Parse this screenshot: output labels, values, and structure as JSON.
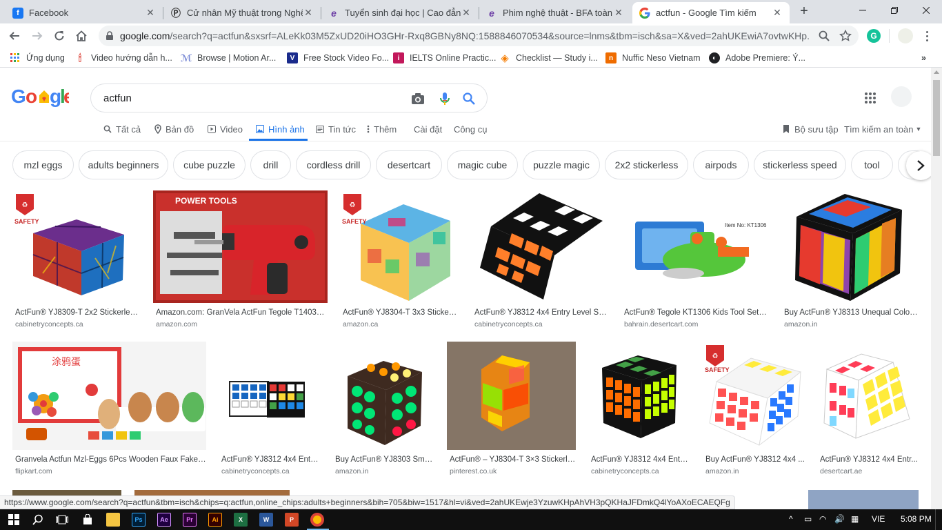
{
  "tabs": [
    {
      "title": "Facebook",
      "icon": "facebook-icon"
    },
    {
      "title": "Cử nhân Mỹ thuật trong Nghệ",
      "icon": "p-icon"
    },
    {
      "title": "Tuyển sinh đại học | Cao đẳng",
      "icon": "e-icon"
    },
    {
      "title": "Phim nghệ thuật - BFA toàn cầ",
      "icon": "e-icon"
    },
    {
      "title": "actfun - Google Tìm kiếm",
      "icon": "google-icon",
      "active": true
    }
  ],
  "omnibox": {
    "host": "google.com",
    "path": "/search?q=actfun&sxsrf=ALeKk03M5ZxUD20iHO3GHr-Rxq8GBNy8NQ:1588846070534&source=lnms&tbm=isch&sa=X&ved=2ahUKEwiA7ovtwKHp..."
  },
  "bookmarks": [
    {
      "label": "Ứng dụng",
      "icon": "apps-grid-icon"
    },
    {
      "label": "Video hướng dẫn h...",
      "icon": "video-icon"
    },
    {
      "label": "Browse | Motion Ar...",
      "icon": "motion-array-icon"
    },
    {
      "label": "Free Stock Video Fo...",
      "icon": "v-icon"
    },
    {
      "label": "IELTS Online Practic...",
      "icon": "ielts-icon"
    },
    {
      "label": "Checklist — Study i...",
      "icon": "checklist-icon"
    },
    {
      "label": "Nuffic Neso Vietnam",
      "icon": "nuffic-icon"
    },
    {
      "label": "Adobe Premiere: Ý...",
      "icon": "premiere-icon"
    }
  ],
  "search": {
    "query": "actfun"
  },
  "nav": {
    "all": "Tất cả",
    "maps": "Bản đồ",
    "video": "Video",
    "images": "Hình ảnh",
    "news": "Tin tức",
    "more": "Thêm",
    "settings": "Cài đặt",
    "tools": "Công cụ",
    "collections": "Bộ sưu tập",
    "safesearch": "Tìm kiếm an toàn"
  },
  "chips": [
    "mzl eggs",
    "adults beginners",
    "cube puzzle",
    "drill",
    "cordless drill",
    "desertcart",
    "magic cube",
    "puzzle magic",
    "2x2 stickerless",
    "airpods",
    "stickerless speed",
    "tool",
    "puzzle"
  ],
  "results": [
    {
      "title": "ActFun® YJ8309-T 2x2 Stickerless...",
      "source": "cabinetryconcepts.ca",
      "badge": "SAFETY"
    },
    {
      "title": "Amazon.com: GranVela ActFun Tegole T1403 D...",
      "source": "amazon.com",
      "badge": "POWER TOOLS"
    },
    {
      "title": "ActFun® YJ8304-T 3x3 Stickerl...",
      "source": "amazon.ca",
      "badge": "SAFETY"
    },
    {
      "title": "ActFun® YJ8312 4x4 Entry Level Spe...",
      "source": "cabinetryconcepts.ca"
    },
    {
      "title": "ActFun® Tegole KT1306 Kids Tool Set C...",
      "source": "bahrain.desertcart.com",
      "badge": "Item No: KT1306"
    },
    {
      "title": "Buy ActFun® YJ8313 Unequal Colorf...",
      "source": "amazon.in"
    },
    {
      "title": "Granvela Actfun Mzl-Eggs 6Pcs Wooden Faux Fake E...",
      "source": "flipkart.com",
      "badge": "3+"
    },
    {
      "title": "ActFun® YJ8312 4x4 Entry...",
      "source": "cabinetryconcepts.ca"
    },
    {
      "title": "Buy ActFun® YJ8303 Smo...",
      "source": "amazon.in"
    },
    {
      "title": "ActFun® – YJ8304-T 3×3 Stickerle...",
      "source": "pinterest.co.uk"
    },
    {
      "title": "ActFun® YJ8312 4x4 Entry...",
      "source": "cabinetryconcepts.ca"
    },
    {
      "title": "Buy ActFun® YJ8312 4x4 ...",
      "source": "amazon.in",
      "badge": "SAFETY"
    },
    {
      "title": "ActFun® YJ8312 4x4 Entr...",
      "source": "desertcart.ae"
    }
  ],
  "status_url": "https://www.google.com/search?q=actfun&tbm=isch&chips=q:actfun,online_chips:adults+beginners&bih=705&biw=1517&hl=vi&ved=2ahUKEwje3YzuwKHpAhVH3pQKHaJFDmkQ4lYoAXoECAEQFg",
  "taskbar": {
    "language": "VIE",
    "time": "5:08 PM"
  },
  "colors": {
    "accent": "#1a73e8",
    "tabstrip": "#dee1e6"
  }
}
